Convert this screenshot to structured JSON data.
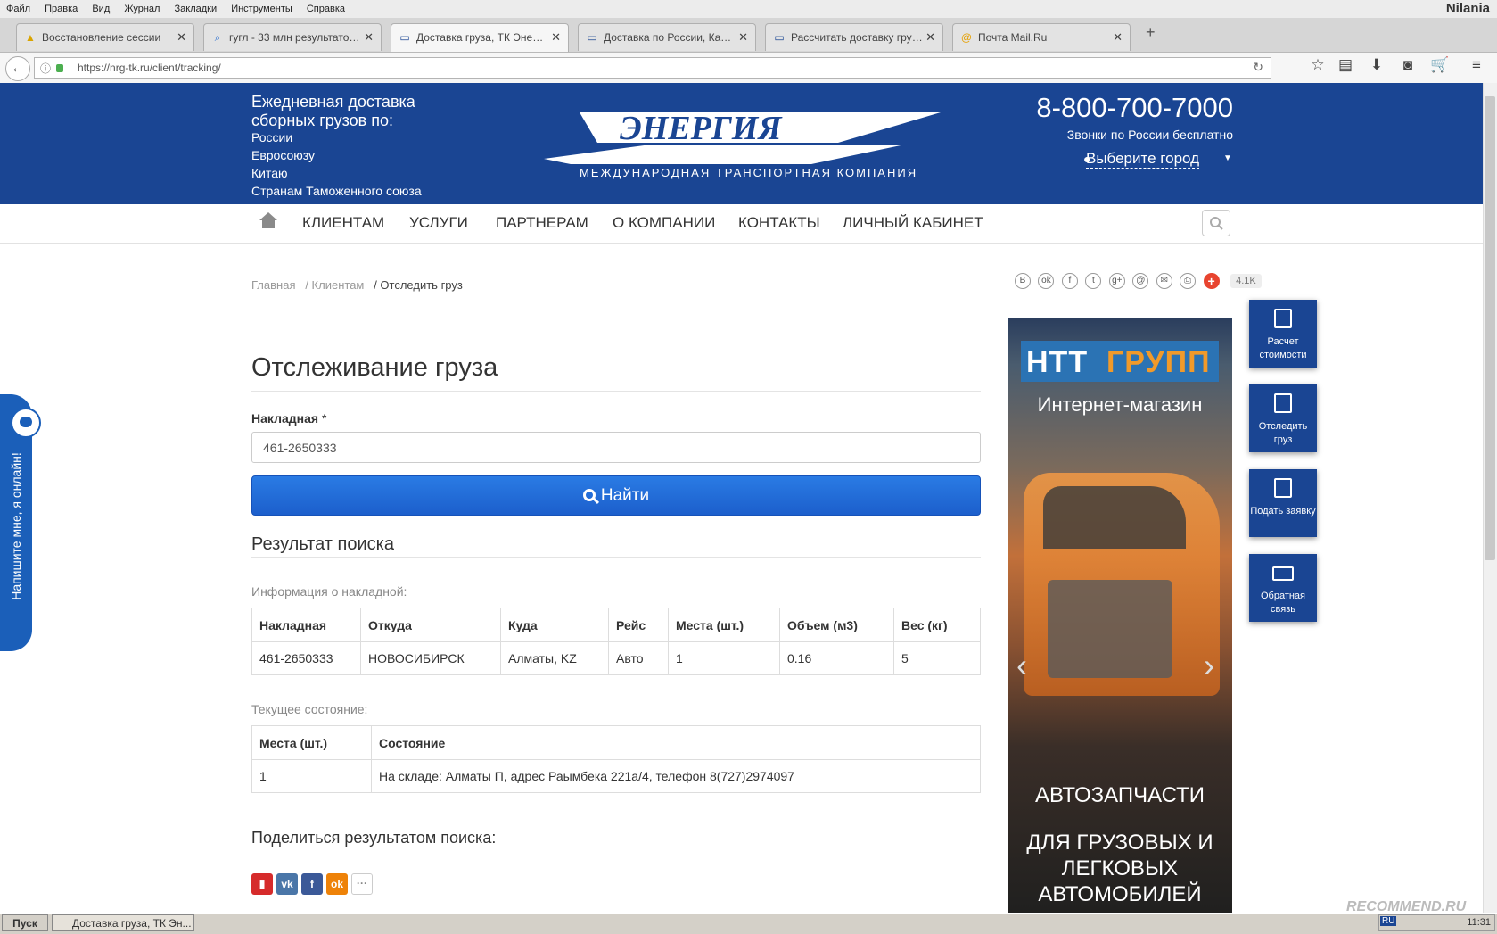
{
  "browser": {
    "menu": [
      "Файл",
      "Правка",
      "Вид",
      "Журнал",
      "Закладки",
      "Инструменты",
      "Справка"
    ],
    "user": "Nilania",
    "tabs": [
      {
        "title": "Восстановление сессии",
        "icon": "warning-icon"
      },
      {
        "title": "гугл - 33 млн результатов. ...",
        "icon": "search-icon"
      },
      {
        "title": "Доставка груза, ТК Энерги...",
        "icon": "truck-icon"
      },
      {
        "title": "Доставка по России, Казахс...",
        "icon": "truck-icon"
      },
      {
        "title": "Рассчитать доставку груза...",
        "icon": "truck-icon"
      },
      {
        "title": "Почта Mail.Ru",
        "icon": "mail-icon"
      }
    ],
    "url": "https://nrg-tk.ru/client/tracking/"
  },
  "header": {
    "intro": "Ежедневная доставка сборных грузов по:",
    "regions": [
      "России",
      "Евросоюзу",
      "Китаю",
      "Странам Таможенного союза"
    ],
    "logo_text": "ЭНЕРГИЯ",
    "logo_sub": "МЕЖДУНАРОДНАЯ ТРАНСПОРТНАЯ КОМПАНИЯ",
    "phone": "8-800-700-7000",
    "phone_note": "Звонки по России бесплатно",
    "city": "Выберите город"
  },
  "nav": [
    "КЛИЕНТАМ",
    "УСЛУГИ",
    "ПАРТНЕРАМ",
    "О КОМПАНИИ",
    "КОНТАКТЫ",
    "ЛИЧНЫЙ КАБИНЕТ"
  ],
  "breadcrumbs": {
    "home": "Главная",
    "clients": "/ Клиентам",
    "current": "/ Отследить груз"
  },
  "share_top": {
    "icons": [
      "В",
      "ok",
      "f",
      "t",
      "g+",
      "@",
      "✉",
      "⎙"
    ],
    "count": "4.1K"
  },
  "tracking": {
    "title": "Отслеживание груза",
    "field_label": "Накладная",
    "field_required": " *",
    "field_value": "461-2650333",
    "button": "Найти",
    "result_title": "Результат поиска",
    "info_label": "Информация о накладной:",
    "info_headers": [
      "Накладная",
      "Откуда",
      "Куда",
      "Рейс",
      "Места (шт.)",
      "Объем (м3)",
      "Вес (кг)"
    ],
    "info_row": [
      "461-2650333",
      "НОВОСИБИРСК",
      "Алматы, KZ",
      "Авто",
      "1",
      "0.16",
      "5"
    ],
    "state_label": "Текущее состояние:",
    "state_headers": [
      "Места (шт.)",
      "Состояние"
    ],
    "state_row": [
      "1",
      "На складе: Алматы П, адрес Раымбека 221а/4, телефон 8(727)2974097"
    ],
    "share_title": "Поделиться результатом поиска:"
  },
  "ad": {
    "brand_left": "НТТ",
    "brand_right": "ГРУПП",
    "subtitle": "Интернет-магазин",
    "line1": "АВТОЗАПЧАСТИ",
    "line2": "ДЛЯ ГРУЗОВЫХ И ЛЕГКОВЫХ АВТОМОБИЛЕЙ"
  },
  "quick": [
    {
      "label": "Расчет стоимости",
      "icon": "calculator-icon"
    },
    {
      "label": "Отследить груз",
      "icon": "track-document-icon"
    },
    {
      "label": "Подать заявку",
      "icon": "request-form-icon"
    },
    {
      "label": "Обратная связь",
      "icon": "envelope-icon"
    }
  ],
  "chat": "Напишите мне, я онлайн!",
  "taskbar": {
    "start": "Пуск",
    "window": "Доставка груза, ТК Эн...",
    "lang": "RU",
    "time": "11:31"
  },
  "watermark": "RECOMMEND.RU",
  "colors": {
    "brand": "#1a4593",
    "button": "#1c5fcc",
    "chat": "#1b5fb9"
  }
}
